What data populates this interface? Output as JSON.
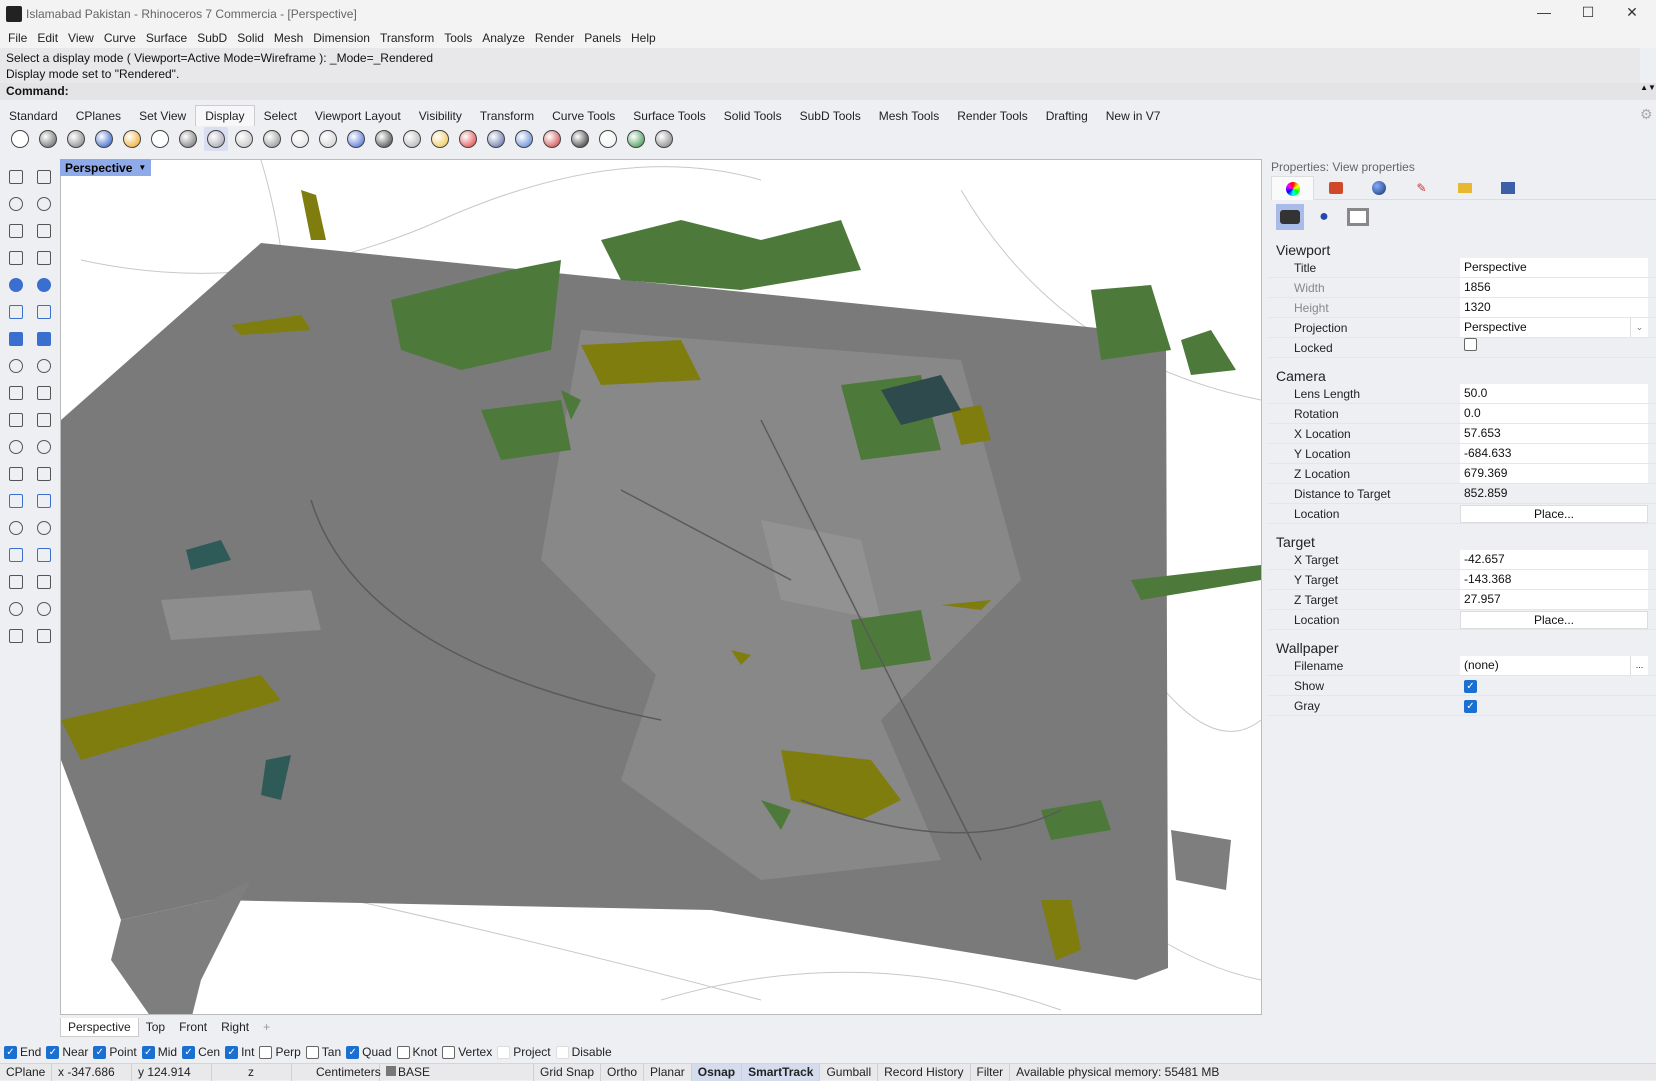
{
  "window": {
    "title": "Islamabad Pakistan - Rhinoceros 7 Commercia - [Perspective]",
    "minimize": "—",
    "maximize": "☐",
    "close": "✕"
  },
  "menu": [
    "File",
    "Edit",
    "View",
    "Curve",
    "Surface",
    "SubD",
    "Solid",
    "Mesh",
    "Dimension",
    "Transform",
    "Tools",
    "Analyze",
    "Render",
    "Panels",
    "Help"
  ],
  "command": {
    "history": [
      "Select a display mode ( Viewport=Active  Mode=Wireframe ): _Mode=_Rendered",
      "Display mode set to \"Rendered\"."
    ],
    "prompt": "Command:"
  },
  "toolbar_tabs": [
    "Standard",
    "CPlanes",
    "Set View",
    "Display",
    "Select",
    "Viewport Layout",
    "Visibility",
    "Transform",
    "Curve Tools",
    "Surface Tools",
    "Solid Tools",
    "SubD Tools",
    "Mesh Tools",
    "Render Tools",
    "Drafting",
    "New in V7"
  ],
  "active_tab": "Display",
  "toolbar_icons": [
    "wireframe-icon",
    "shaded-icon",
    "rendered-icon",
    "ghosted-icon",
    "xray-icon",
    "technical-icon",
    "artistic-icon",
    "pen-icon",
    "arctic-icon",
    "raytraced-icon",
    "mouse-icon",
    "zebra-icon",
    "environment-icon",
    "curvature-icon",
    "draft-angle-icon",
    "emap-icon",
    "light-icon",
    "cplane-icon",
    "section-icon",
    "clipping-icon",
    "hide-icon",
    "monitor-icon",
    "box-icon",
    "color-icon"
  ],
  "viewport": {
    "label": "Perspective",
    "tabs": [
      "Perspective",
      "Top",
      "Front",
      "Right"
    ],
    "add": "+"
  },
  "osnaps": [
    {
      "label": "End",
      "on": true
    },
    {
      "label": "Near",
      "on": true
    },
    {
      "label": "Point",
      "on": true
    },
    {
      "label": "Mid",
      "on": true
    },
    {
      "label": "Cen",
      "on": true
    },
    {
      "label": "Int",
      "on": true
    },
    {
      "label": "Perp",
      "on": false
    },
    {
      "label": "Tan",
      "on": false
    },
    {
      "label": "Quad",
      "on": true
    },
    {
      "label": "Knot",
      "on": false
    },
    {
      "label": "Vertex",
      "on": false
    },
    {
      "label": "Project",
      "on": false
    },
    {
      "label": "Disable",
      "on": false
    }
  ],
  "status": {
    "cplane": "CPlane",
    "x": "x -347.686",
    "y": "y 124.914",
    "z": "z",
    "units": "Centimeters",
    "layer": "BASE",
    "grid_snap": "Grid Snap",
    "ortho": "Ortho",
    "planar": "Planar",
    "osnap": "Osnap",
    "smarttrack": "SmartTrack",
    "gumball": "Gumball",
    "record_history": "Record History",
    "filter": "Filter",
    "memory": "Available physical memory: 55481 MB"
  },
  "properties": {
    "title": "Properties: View properties",
    "viewport": {
      "heading": "Viewport",
      "title_label": "Title",
      "title": "Perspective",
      "width_label": "Width",
      "width": "1856",
      "height_label": "Height",
      "height": "1320",
      "projection_label": "Projection",
      "projection": "Perspective",
      "locked_label": "Locked",
      "locked": false
    },
    "camera": {
      "heading": "Camera",
      "lens_label": "Lens Length",
      "lens": "50.0",
      "rotation_label": "Rotation",
      "rotation": "0.0",
      "xloc_label": "X Location",
      "xloc": "57.653",
      "yloc_label": "Y Location",
      "yloc": "-684.633",
      "zloc_label": "Z Location",
      "zloc": "679.369",
      "dist_label": "Distance to Target",
      "dist": "852.859",
      "location_label": "Location",
      "place": "Place..."
    },
    "target": {
      "heading": "Target",
      "x_label": "X Target",
      "x": "-42.657",
      "y_label": "Y Target",
      "y": "-143.368",
      "z_label": "Z Target",
      "z": "27.957",
      "location_label": "Location",
      "place": "Place..."
    },
    "wallpaper": {
      "heading": "Wallpaper",
      "filename_label": "Filename",
      "filename": "(none)",
      "browse": "...",
      "show_label": "Show",
      "show": true,
      "gray_label": "Gray",
      "gray": true
    }
  }
}
